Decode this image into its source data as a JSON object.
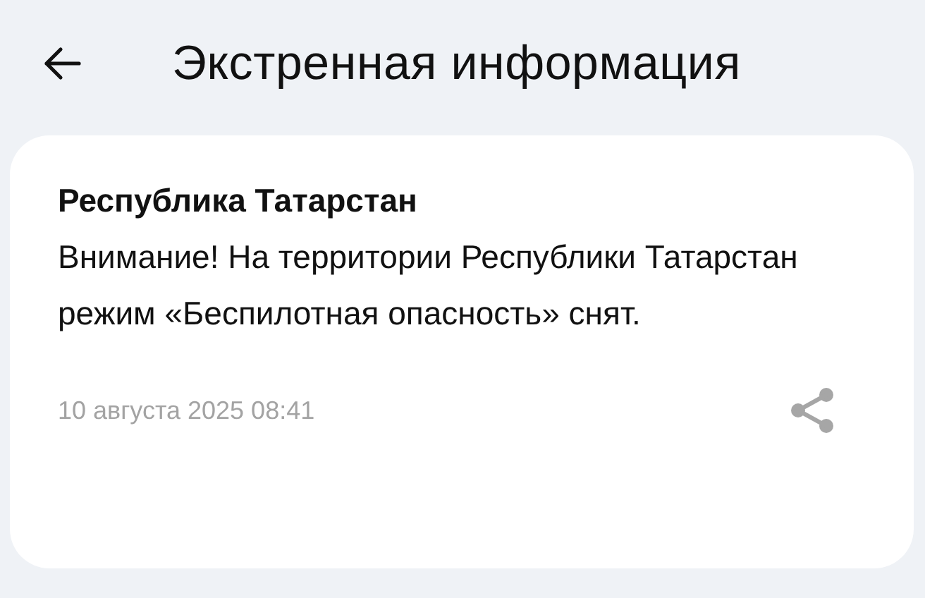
{
  "header": {
    "title": "Экстренная информация"
  },
  "alert": {
    "region": "Республика Татарстан",
    "message": "Внимание! На территории Республики Татарстан режим «Беспилотная опасность» снят.",
    "date": "10 августа 2025 08:41"
  }
}
